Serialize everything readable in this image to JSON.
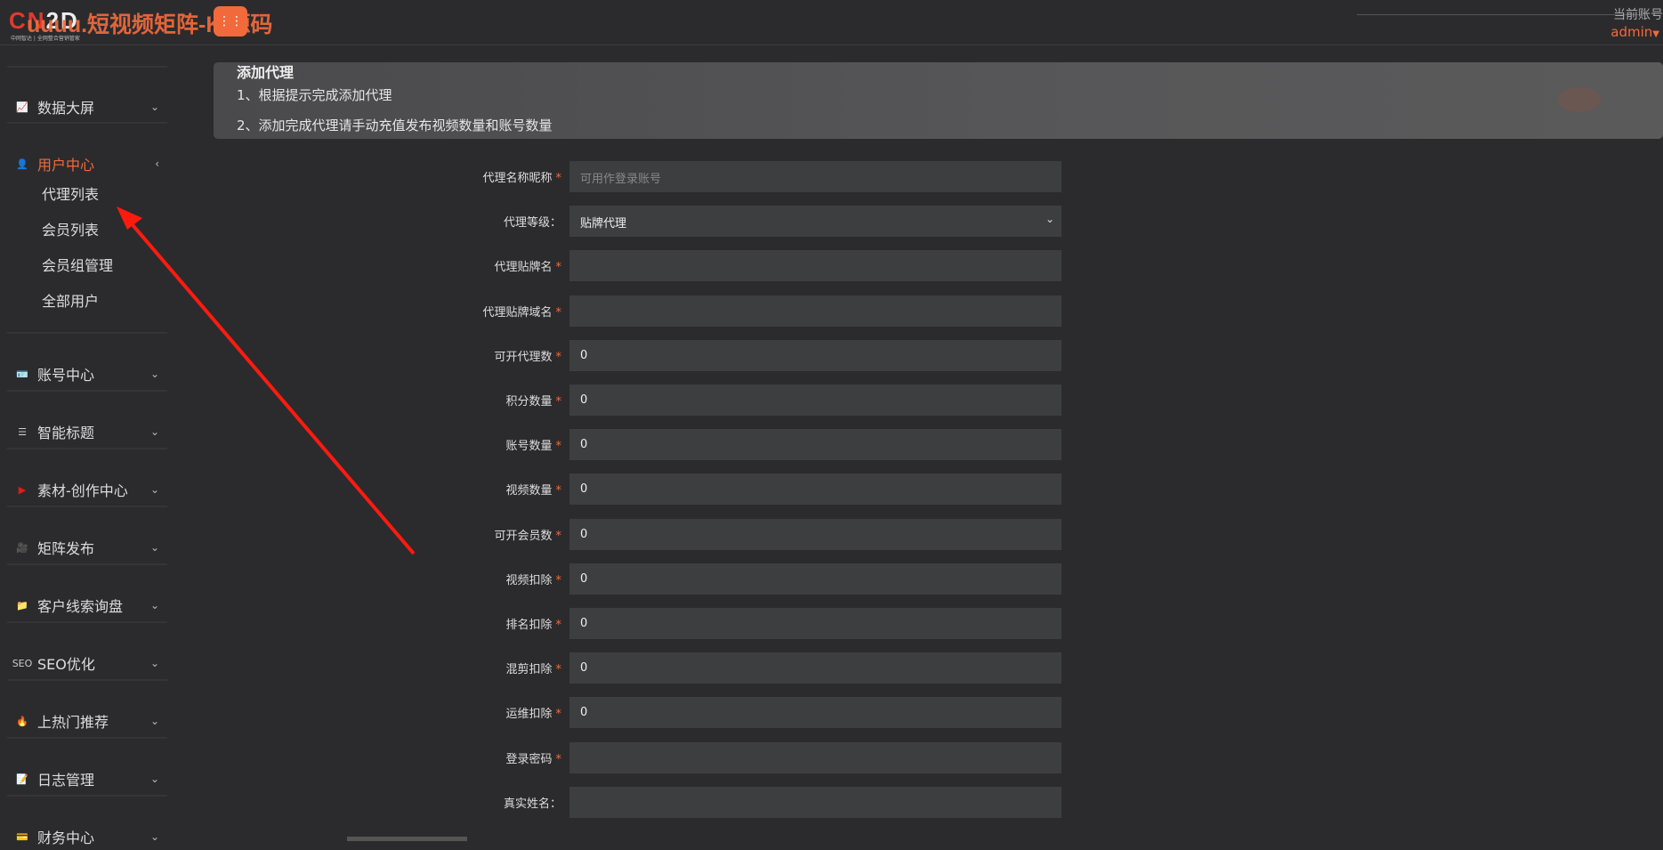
{
  "header": {
    "logo_text": "CN2D",
    "logo_sub": "中网智达 | 全网整合营销管家",
    "watermark": "uuuu.短视频矩阵-KI源码",
    "account_label": "当前账号",
    "account_user": "admin"
  },
  "sidebar": {
    "items": [
      {
        "label": "数据大屏",
        "icon": "chart-icon"
      },
      {
        "label": "用户中心",
        "icon": "user-icon",
        "active": true,
        "children": [
          "代理列表",
          "会员列表",
          "会员组管理",
          "全部用户"
        ]
      },
      {
        "label": "账号中心",
        "icon": "account-card-icon"
      },
      {
        "label": "智能标题",
        "icon": "title-icon"
      },
      {
        "label": "素材-创作中心",
        "icon": "video-play-icon"
      },
      {
        "label": "矩阵发布",
        "icon": "camera-icon"
      },
      {
        "label": "客户线索询盘",
        "icon": "folder-icon"
      },
      {
        "label": "SEO优化",
        "icon": "seo-icon"
      },
      {
        "label": "上热门推荐",
        "icon": "fire-icon"
      },
      {
        "label": "日志管理",
        "icon": "notebook-icon"
      },
      {
        "label": "财务中心",
        "icon": "finance-icon"
      }
    ]
  },
  "banner": {
    "title": "添加代理",
    "line1": "1、根据提示完成添加代理",
    "line2": "2、添加完成代理请手动充值发布视频数量和账号数量"
  },
  "form": {
    "fields": [
      {
        "label": "代理名称昵称",
        "required": true,
        "value": "",
        "placeholder": "可用作登录账号"
      },
      {
        "label": "代理等级：",
        "type": "select",
        "value": "贴牌代理"
      },
      {
        "label": "代理贴牌名",
        "required": true,
        "value": ""
      },
      {
        "label": "代理贴牌域名",
        "required": true,
        "value": ""
      },
      {
        "label": "可开代理数",
        "required": true,
        "value": "0"
      },
      {
        "label": "积分数量",
        "required": true,
        "value": "0"
      },
      {
        "label": "账号数量",
        "required": true,
        "value": "0"
      },
      {
        "label": "视频数量",
        "required": true,
        "value": "0"
      },
      {
        "label": "可开会员数",
        "required": true,
        "value": "0"
      },
      {
        "label": "视频扣除",
        "required": true,
        "value": "0"
      },
      {
        "label": "排名扣除",
        "required": true,
        "value": "0"
      },
      {
        "label": "混剪扣除",
        "required": true,
        "value": "0"
      },
      {
        "label": "运维扣除",
        "required": true,
        "value": "0"
      },
      {
        "label": "登录密码",
        "required": true,
        "value": ""
      },
      {
        "label": "真实姓名：",
        "value": ""
      }
    ]
  },
  "colors": {
    "accent": "#f26a3c",
    "bg": "#2b2b2d",
    "input": "#3d3e3f"
  }
}
